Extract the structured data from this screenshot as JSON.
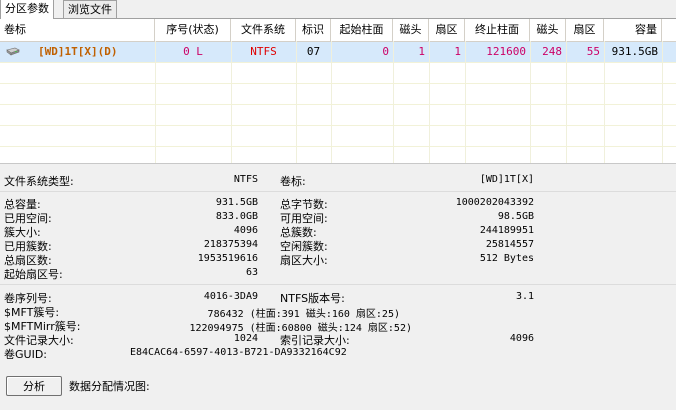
{
  "tabs": [
    "分区参数",
    "浏览文件"
  ],
  "table": {
    "headers": [
      "卷标",
      "序号(状态)",
      "文件系统",
      "标识",
      "起始柱面",
      "磁头",
      "扇区",
      "终止柱面",
      "磁头",
      "扇区",
      "容量"
    ],
    "row": {
      "label": "[WD]1T[X](D)",
      "index_status": "0 L",
      "fs": "NTFS",
      "id": "07",
      "start_cyl": "0",
      "start_head": "1",
      "start_sec": "1",
      "end_cyl": "121600",
      "end_head": "248",
      "end_sec": "55",
      "capacity": "931.5GB"
    }
  },
  "info": {
    "fs_type_label": "文件系统类型:",
    "fs_type": "NTFS",
    "vol_label_label": "卷标:",
    "vol_label": "[WD]1T[X]",
    "total_cap_label": "总容量:",
    "total_cap": "931.5GB",
    "total_bytes_label": "总字节数:",
    "total_bytes": "1000202043392",
    "used_label": "已用空间:",
    "used": "833.0GB",
    "free_label": "可用空间:",
    "free": "98.5GB",
    "cluster_size_label": "簇大小:",
    "cluster_size": "4096",
    "total_clusters_label": "总簇数:",
    "total_clusters": "244189951",
    "used_clusters_label": "已用簇数:",
    "used_clusters": "218375394",
    "free_clusters_label": "空闲簇数:",
    "free_clusters": "25814557",
    "total_sectors_label": "总扇区数:",
    "total_sectors": "1953519616",
    "sector_size_label": "扇区大小:",
    "sector_size": "512 Bytes",
    "start_sector_label": "起始扇区号:",
    "start_sector": "63",
    "serial_label": "卷序列号:",
    "serial": "4016-3DA9",
    "ntfs_ver_label": "NTFS版本号:",
    "ntfs_ver": "3.1",
    "mft_label": "$MFT簇号:",
    "mft": "786432 (柱面:391 磁头:160 扇区:25)",
    "mftmirr_label": "$MFTMirr簇号:",
    "mftmirr": "122094975 (柱面:60800 磁头:124 扇区:52)",
    "file_rec_label": "文件记录大小:",
    "file_rec": "1024",
    "index_rec_label": "索引记录大小:",
    "index_rec": "4096",
    "guid_label": "卷GUID:",
    "guid": "E84CAC64-6597-4013-B721-DA9332164C92"
  },
  "analyze_button": "分析",
  "distribution_label": "数据分配情况图:",
  "colors": {
    "pink": "#cc0066",
    "red": "#e00000",
    "selection": "#d6e9fb",
    "orange": "#c06000"
  }
}
